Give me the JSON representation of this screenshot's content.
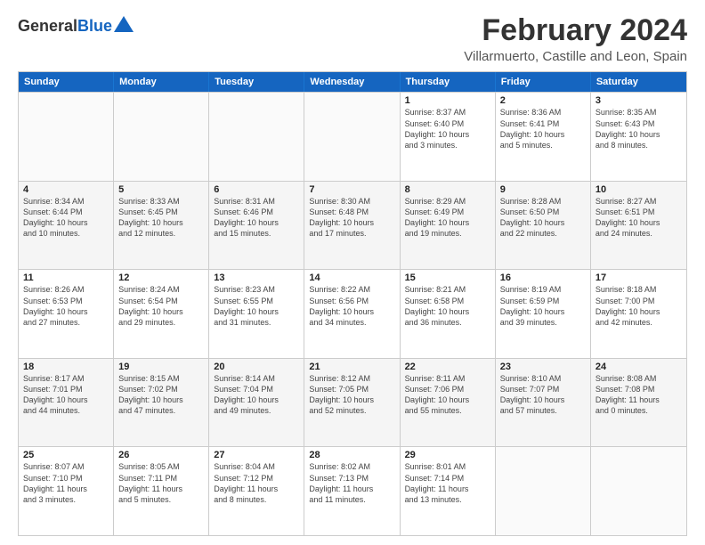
{
  "header": {
    "logo_line1": "General",
    "logo_line2": "Blue",
    "month_title": "February 2024",
    "location": "Villarmuerto, Castille and Leon, Spain"
  },
  "days_of_week": [
    "Sunday",
    "Monday",
    "Tuesday",
    "Wednesday",
    "Thursday",
    "Friday",
    "Saturday"
  ],
  "weeks": [
    [
      {
        "day": "",
        "info": ""
      },
      {
        "day": "",
        "info": ""
      },
      {
        "day": "",
        "info": ""
      },
      {
        "day": "",
        "info": ""
      },
      {
        "day": "1",
        "info": "Sunrise: 8:37 AM\nSunset: 6:40 PM\nDaylight: 10 hours\nand 3 minutes."
      },
      {
        "day": "2",
        "info": "Sunrise: 8:36 AM\nSunset: 6:41 PM\nDaylight: 10 hours\nand 5 minutes."
      },
      {
        "day": "3",
        "info": "Sunrise: 8:35 AM\nSunset: 6:43 PM\nDaylight: 10 hours\nand 8 minutes."
      }
    ],
    [
      {
        "day": "4",
        "info": "Sunrise: 8:34 AM\nSunset: 6:44 PM\nDaylight: 10 hours\nand 10 minutes."
      },
      {
        "day": "5",
        "info": "Sunrise: 8:33 AM\nSunset: 6:45 PM\nDaylight: 10 hours\nand 12 minutes."
      },
      {
        "day": "6",
        "info": "Sunrise: 8:31 AM\nSunset: 6:46 PM\nDaylight: 10 hours\nand 15 minutes."
      },
      {
        "day": "7",
        "info": "Sunrise: 8:30 AM\nSunset: 6:48 PM\nDaylight: 10 hours\nand 17 minutes."
      },
      {
        "day": "8",
        "info": "Sunrise: 8:29 AM\nSunset: 6:49 PM\nDaylight: 10 hours\nand 19 minutes."
      },
      {
        "day": "9",
        "info": "Sunrise: 8:28 AM\nSunset: 6:50 PM\nDaylight: 10 hours\nand 22 minutes."
      },
      {
        "day": "10",
        "info": "Sunrise: 8:27 AM\nSunset: 6:51 PM\nDaylight: 10 hours\nand 24 minutes."
      }
    ],
    [
      {
        "day": "11",
        "info": "Sunrise: 8:26 AM\nSunset: 6:53 PM\nDaylight: 10 hours\nand 27 minutes."
      },
      {
        "day": "12",
        "info": "Sunrise: 8:24 AM\nSunset: 6:54 PM\nDaylight: 10 hours\nand 29 minutes."
      },
      {
        "day": "13",
        "info": "Sunrise: 8:23 AM\nSunset: 6:55 PM\nDaylight: 10 hours\nand 31 minutes."
      },
      {
        "day": "14",
        "info": "Sunrise: 8:22 AM\nSunset: 6:56 PM\nDaylight: 10 hours\nand 34 minutes."
      },
      {
        "day": "15",
        "info": "Sunrise: 8:21 AM\nSunset: 6:58 PM\nDaylight: 10 hours\nand 36 minutes."
      },
      {
        "day": "16",
        "info": "Sunrise: 8:19 AM\nSunset: 6:59 PM\nDaylight: 10 hours\nand 39 minutes."
      },
      {
        "day": "17",
        "info": "Sunrise: 8:18 AM\nSunset: 7:00 PM\nDaylight: 10 hours\nand 42 minutes."
      }
    ],
    [
      {
        "day": "18",
        "info": "Sunrise: 8:17 AM\nSunset: 7:01 PM\nDaylight: 10 hours\nand 44 minutes."
      },
      {
        "day": "19",
        "info": "Sunrise: 8:15 AM\nSunset: 7:02 PM\nDaylight: 10 hours\nand 47 minutes."
      },
      {
        "day": "20",
        "info": "Sunrise: 8:14 AM\nSunset: 7:04 PM\nDaylight: 10 hours\nand 49 minutes."
      },
      {
        "day": "21",
        "info": "Sunrise: 8:12 AM\nSunset: 7:05 PM\nDaylight: 10 hours\nand 52 minutes."
      },
      {
        "day": "22",
        "info": "Sunrise: 8:11 AM\nSunset: 7:06 PM\nDaylight: 10 hours\nand 55 minutes."
      },
      {
        "day": "23",
        "info": "Sunrise: 8:10 AM\nSunset: 7:07 PM\nDaylight: 10 hours\nand 57 minutes."
      },
      {
        "day": "24",
        "info": "Sunrise: 8:08 AM\nSunset: 7:08 PM\nDaylight: 11 hours\nand 0 minutes."
      }
    ],
    [
      {
        "day": "25",
        "info": "Sunrise: 8:07 AM\nSunset: 7:10 PM\nDaylight: 11 hours\nand 3 minutes."
      },
      {
        "day": "26",
        "info": "Sunrise: 8:05 AM\nSunset: 7:11 PM\nDaylight: 11 hours\nand 5 minutes."
      },
      {
        "day": "27",
        "info": "Sunrise: 8:04 AM\nSunset: 7:12 PM\nDaylight: 11 hours\nand 8 minutes."
      },
      {
        "day": "28",
        "info": "Sunrise: 8:02 AM\nSunset: 7:13 PM\nDaylight: 11 hours\nand 11 minutes."
      },
      {
        "day": "29",
        "info": "Sunrise: 8:01 AM\nSunset: 7:14 PM\nDaylight: 11 hours\nand 13 minutes."
      },
      {
        "day": "",
        "info": ""
      },
      {
        "day": "",
        "info": ""
      }
    ]
  ]
}
